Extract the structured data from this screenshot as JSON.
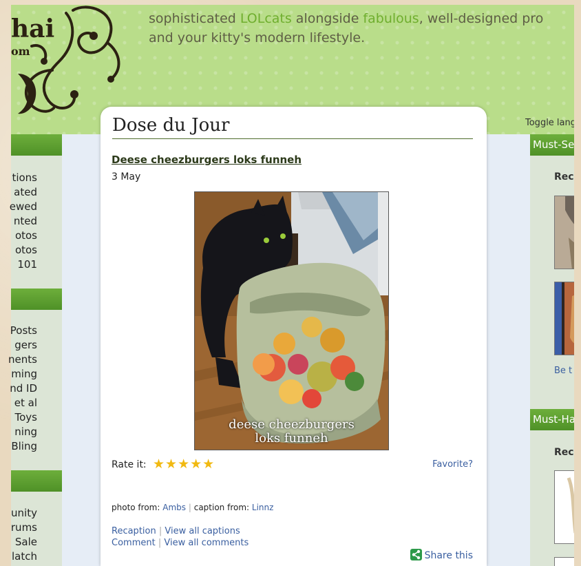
{
  "header": {
    "logo_text_1": "hai",
    "logo_text_2": "om",
    "tagline_pre": "sophisticated ",
    "tagline_hl1": "LOLcats",
    "tagline_mid": " alongside ",
    "tagline_hl2": "fabulous",
    "tagline_post": ", well-designed pro",
    "tagline_line2": "and your kitty's modern lifestyle.",
    "toggle_label": "Toggle lang"
  },
  "left_sidebar": {
    "group1": [
      "tions",
      "ated",
      "ewed",
      "nted",
      "otos",
      "otos",
      "101"
    ],
    "group2": [
      "Posts",
      "gers",
      "nents",
      "ming",
      "nd ID",
      "et al",
      "Toys",
      "ning",
      "Bling"
    ],
    "group3": [
      "unity",
      "rums",
      "Sale",
      "latch"
    ]
  },
  "card": {
    "section_title": "Dose du Jour",
    "post_title": "Deese cheezburgers loks funneh",
    "date": "3 May",
    "caption_line1": "deese cheezburgers",
    "caption_line2": "loks funneh",
    "rate_label": "Rate it:",
    "stars": "★★★★★",
    "favorite": "Favorite?",
    "credit_photo_label": "photo from:",
    "credit_photo_user": "Ambs",
    "credit_caption_label": "caption from:",
    "credit_caption_user": "Linnz",
    "recaption": "Recaption",
    "view_captions": "View all captions",
    "comment": "Comment",
    "view_comments": "View all comments",
    "share": "Share this"
  },
  "right_sidebar": {
    "box1_title": "Must-Se",
    "box1_label": "Rec",
    "link": "Be t",
    "box2_title": "Must-Ha",
    "box2_label": "Rec"
  },
  "colors": {
    "header_green": "#b9dd8a",
    "bar_green": "#5a9e2f",
    "link_blue": "#3a5fa0",
    "star_gold": "#f1b911"
  }
}
